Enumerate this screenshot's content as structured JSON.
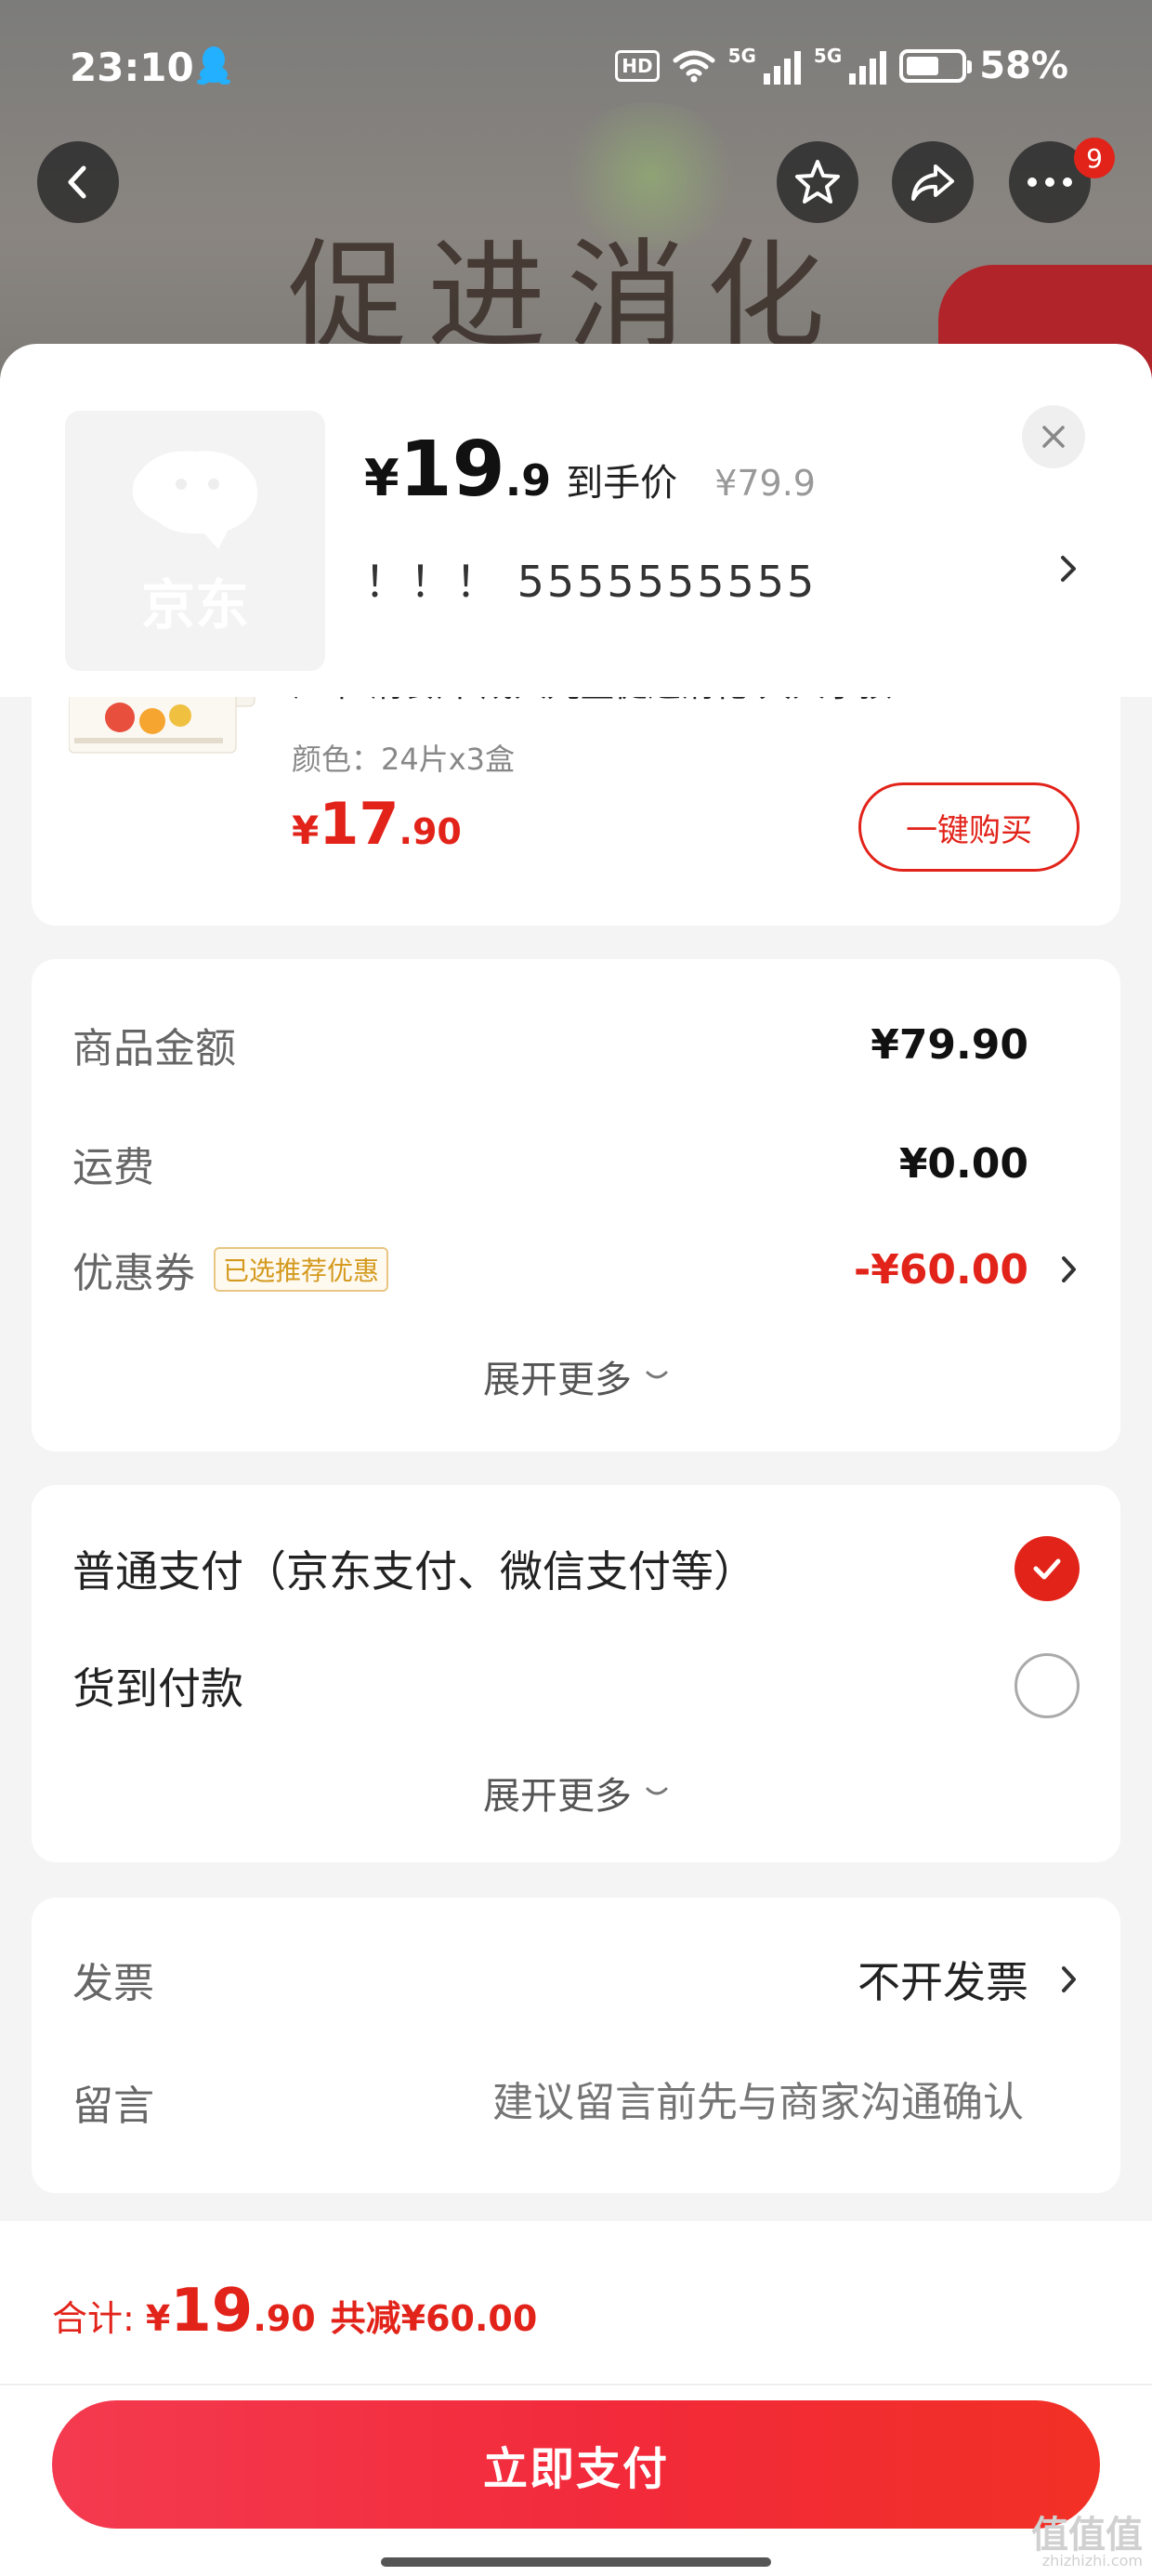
{
  "status_bar": {
    "time": "23:10",
    "hd_label": "HD",
    "net1": "5G",
    "net2": "5G",
    "battery": "58%"
  },
  "background_page": {
    "banner_text": "促进消化"
  },
  "nav": {
    "more_badge": "9"
  },
  "product": {
    "thumb_logo_text": "京东",
    "price_symbol": "¥",
    "price_int": "19",
    "price_dec": ".9",
    "price_tag": "到手价",
    "original_price": "¥79.9",
    "spec": "！！！  5555555555"
  },
  "recommendation": {
    "title": "江中 消食片 成人儿童促进消化 大人小孩...",
    "color": "颜色：24片x3盒",
    "price_symbol": "¥",
    "price_int": "17",
    "price_dec": ".90",
    "buy_label": "一键购买"
  },
  "amounts": {
    "goods_label": "商品金额",
    "goods_value": "¥79.90",
    "shipping_label": "运费",
    "shipping_value": "¥0.00",
    "coupon_label": "优惠券",
    "coupon_badge": "已选推荐优惠",
    "coupon_value": "-¥60.00",
    "expand_label": "展开更多"
  },
  "payment": {
    "normal_label": "普通支付（京东支付、微信支付等）",
    "cod_label": "货到付款",
    "selected": "normal",
    "expand_label": "展开更多"
  },
  "invoice": {
    "invoice_label": "发票",
    "invoice_value": "不开发票",
    "remark_label": "留言",
    "remark_placeholder": "建议留言前先与商家沟通确认"
  },
  "footer": {
    "total_label": "合计:",
    "total_symbol": "¥",
    "total_int": "19",
    "total_dec": ".90",
    "total_saved": "共减¥60.00",
    "pay_label": "立即支付"
  },
  "watermark": {
    "main": "值值值",
    "sub": "zhizhizhi.com"
  },
  "colors": {
    "accent_red": "#e2231a",
    "badge_gold": "#d49a1f"
  }
}
